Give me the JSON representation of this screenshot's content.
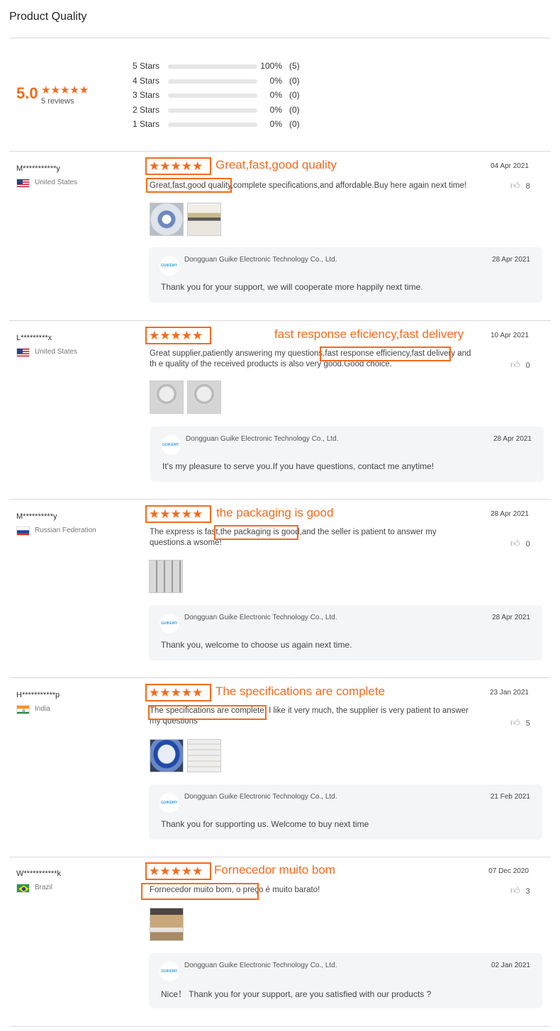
{
  "page_title": "Product Quality",
  "summary": {
    "average": "5.0",
    "stars": "★★★★★",
    "count_label": "5 reviews",
    "accent_color": "#f26b1d",
    "distribution": [
      {
        "label": "5 Stars",
        "fraction": 1.0,
        "percent": "100%",
        "count": "(5)"
      },
      {
        "label": "4 Stars",
        "fraction": 0.0,
        "percent": "0%",
        "count": "(0)"
      },
      {
        "label": "3 Stars",
        "fraction": 0.0,
        "percent": "0%",
        "count": "(0)"
      },
      {
        "label": "2 Stars",
        "fraction": 0.0,
        "percent": "0%",
        "count": "(0)"
      },
      {
        "label": "1 Stars",
        "fraction": 0.0,
        "percent": "0%",
        "count": "(0)"
      }
    ]
  },
  "reviews": [
    {
      "reviewer": "M***********y",
      "flag": "us-flag",
      "country": "United States",
      "stars": "★★★★★",
      "headline": "Great,fast,good quality",
      "date": "04 Apr 2021",
      "text": "Great,fast,good quality,complete specifications,and affordable.Buy here again next time!",
      "likes": "8",
      "images": [
        "reel-photo",
        "tape-strip-photo"
      ],
      "reply": {
        "seller": "Dongguan Guike Electronic Technology Co., Ltd.",
        "date": "28 Apr 2021",
        "text": "Thank you for your support, we will cooperate more happily next time."
      }
    },
    {
      "reviewer": "L*********x",
      "flag": "us-flag",
      "country": "United States",
      "stars": "★★★★★",
      "headline": "fast response eficiency,fast delivery",
      "date": "10 Apr 2021",
      "text": "Great supplier,patiently answering my questions,fast response efficiency,fast delivery and th e quality of the received products is also very good.Good choice.",
      "likes": "0",
      "images": [
        "reel-photo",
        "reel-photo"
      ],
      "reply": {
        "seller": "Dongguan Guike Electronic Technology Co., Ltd.",
        "date": "28 Apr 2021",
        "text": "It's my pleasure to serve you.If you have questions, contact me anytime!"
      }
    },
    {
      "reviewer": "M**********y",
      "flag": "ru-flag",
      "country": "Russian Federation",
      "stars": "★★★★★",
      "headline": "the packaging is good",
      "date": "28 Apr 2021",
      "text": "The express is fast,the packaging is good,and the seller is patient to answer my questions.a wsome!",
      "likes": "0",
      "images": [
        "boxes-photo"
      ],
      "reply": {
        "seller": "Dongguan Guike Electronic Technology Co., Ltd.",
        "date": "28 Apr 2021",
        "text": "Thank you, welcome to choose us again next time."
      }
    },
    {
      "reviewer": "H***********p",
      "flag": "in-flag",
      "country": "India",
      "stars": "★★★★★",
      "headline": "The specifications are complete",
      "date": "23 Jan 2021",
      "text": "The specifications are complete, I like it very much, the supplier is very patient to answer my questions",
      "likes": "5",
      "images": [
        "blue-reel-photo",
        "white-reel-photo"
      ],
      "reply": {
        "seller": "Dongguan Guike Electronic Technology Co., Ltd.",
        "date": "21 Feb 2021",
        "text": "Thank you for supporting us. Welcome to buy next time"
      }
    },
    {
      "reviewer": "W***********k",
      "flag": "br-flag",
      "country": "Brazil",
      "stars": "★★★★★",
      "headline": "Fornecedor muito bom",
      "date": "07 Dec 2020",
      "text": "Fornecedor muito bom, o preço é muito barato!",
      "likes": "3",
      "images": [
        "carton-photo"
      ],
      "reply": {
        "seller": "Dongguan Guike Electronic Technology Co., Ltd.",
        "date": "02 Jan 2021",
        "text": "Nice！ Thank you for your support, are you satisfied with our products ?"
      }
    }
  ]
}
